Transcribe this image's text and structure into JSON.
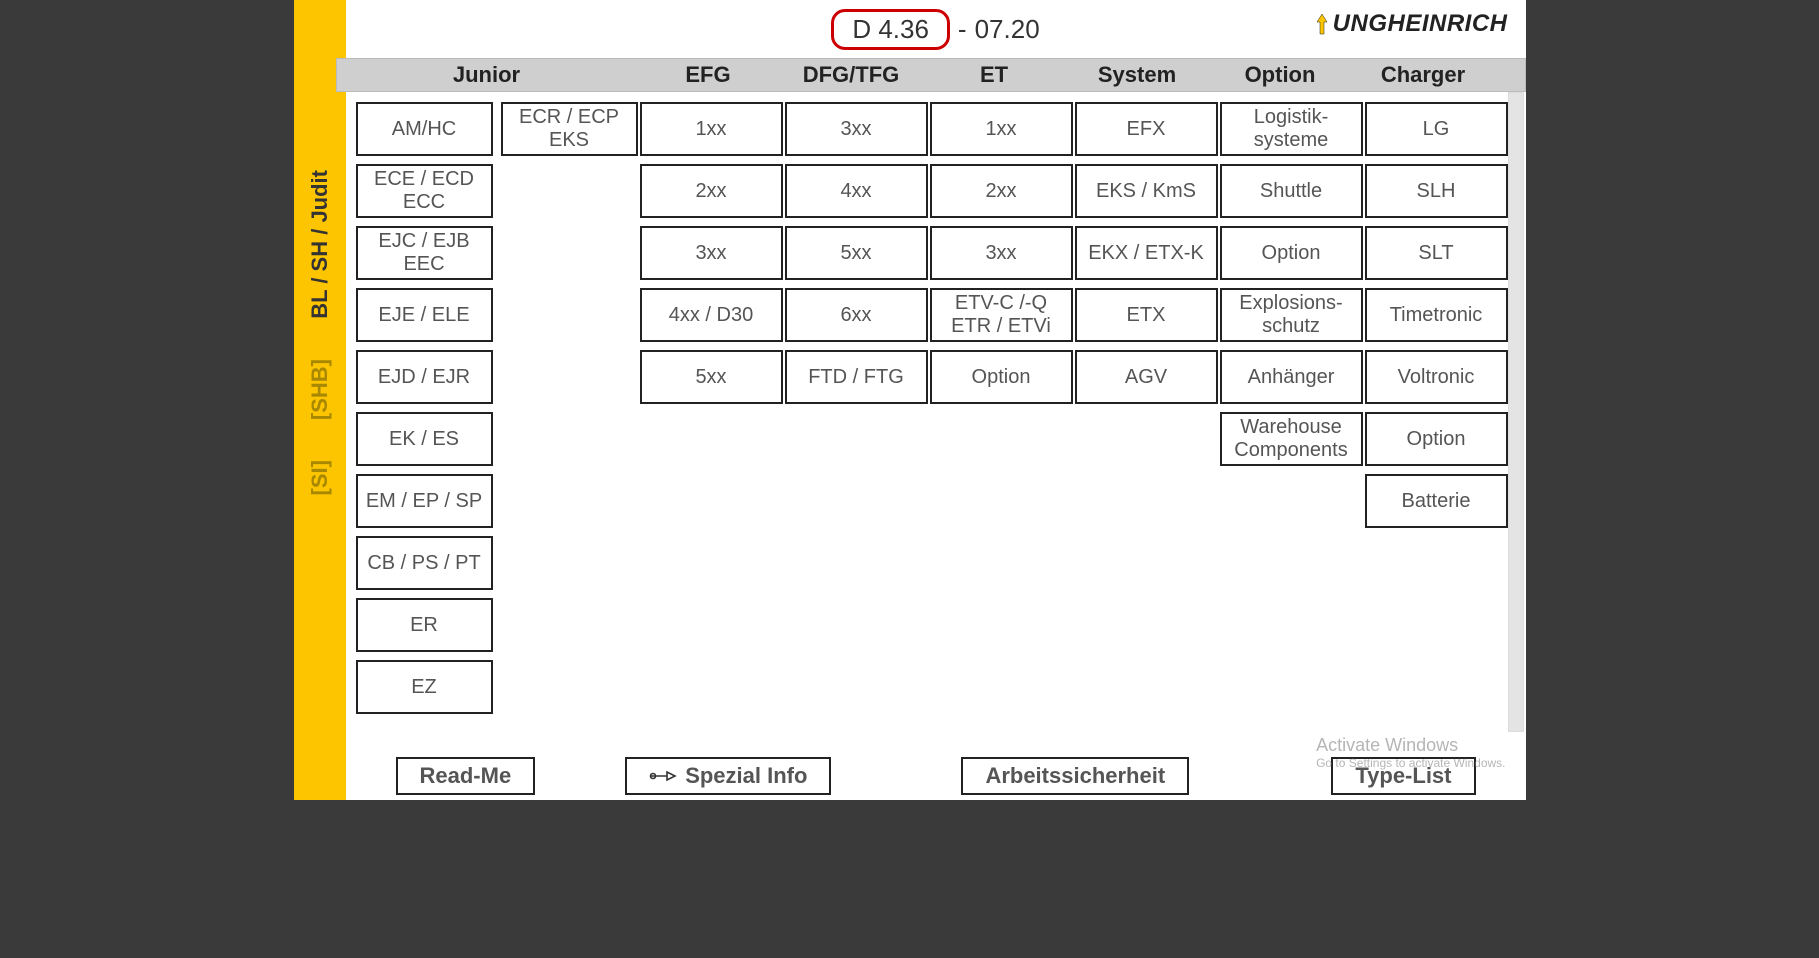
{
  "header": {
    "version_boxed": "D 4.36",
    "version_sep": "-",
    "version_suffix": "07.20",
    "brand": "UNGHEINRICH"
  },
  "sidebar": {
    "item_main": "BL / SH / Judit",
    "item_shb": "[SHB]",
    "item_si": "[SI]"
  },
  "columns": {
    "junior": "Junior",
    "efg": "EFG",
    "dfg": "DFG/TFG",
    "et": "ET",
    "system": "System",
    "option": "Option",
    "charger": "Charger"
  },
  "grid": {
    "junior_a": [
      "AM/HC",
      "ECE / ECD ECC",
      "EJC / EJB EEC",
      "EJE / ELE",
      "EJD / EJR",
      "EK / ES",
      "EM / EP / SP",
      "CB / PS / PT",
      "ER",
      "EZ"
    ],
    "junior_b": [
      "ECR / ECP EKS"
    ],
    "efg": [
      "1xx",
      "2xx",
      "3xx",
      "4xx / D30",
      "5xx"
    ],
    "dfg": [
      "3xx",
      "4xx",
      "5xx",
      "6xx",
      "FTD / FTG"
    ],
    "et": [
      "1xx",
      "2xx",
      "3xx",
      "ETV-C /-Q ETR / ETVi",
      "Option"
    ],
    "system": [
      "EFX",
      "EKS / KmS",
      "EKX / ETX-K",
      "ETX",
      "AGV"
    ],
    "option": [
      "Logistik-systeme",
      "Shuttle",
      "Option",
      "Explosions-schutz",
      "Anhänger",
      "Warehouse Components"
    ],
    "charger": [
      "LG",
      "SLH",
      "SLT",
      "Timetronic",
      "Voltronic",
      "Option",
      "Batterie"
    ]
  },
  "bottom": {
    "readme": "Read-Me",
    "spezial": "Spezial Info",
    "arbeits": "Arbeitssicherheit",
    "typelist": "Type-List"
  },
  "watermark": {
    "title": "Activate Windows",
    "sub": "Go to Settings to activate Windows."
  }
}
